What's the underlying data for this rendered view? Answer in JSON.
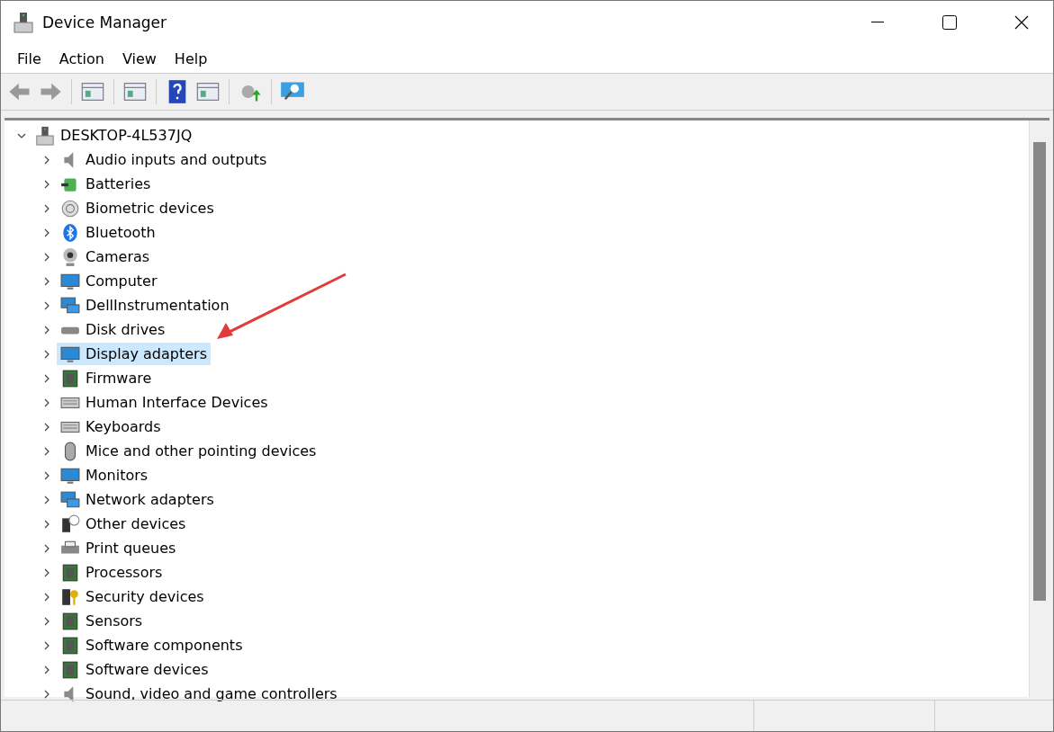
{
  "window": {
    "title": "Device Manager"
  },
  "menu": [
    "File",
    "Action",
    "View",
    "Help"
  ],
  "tree": {
    "label": "DESKTOP-4L537JQ",
    "expanded": true,
    "children": [
      {
        "label": "Audio inputs and outputs",
        "expanded": false,
        "selected": false
      },
      {
        "label": "Batteries",
        "expanded": false,
        "selected": false
      },
      {
        "label": "Biometric devices",
        "expanded": false,
        "selected": false
      },
      {
        "label": "Bluetooth",
        "expanded": false,
        "selected": false
      },
      {
        "label": "Cameras",
        "expanded": false,
        "selected": false
      },
      {
        "label": "Computer",
        "expanded": false,
        "selected": false
      },
      {
        "label": "DellInstrumentation",
        "expanded": false,
        "selected": false
      },
      {
        "label": "Disk drives",
        "expanded": false,
        "selected": false
      },
      {
        "label": "Display adapters",
        "expanded": false,
        "selected": true
      },
      {
        "label": "Firmware",
        "expanded": false,
        "selected": false
      },
      {
        "label": "Human Interface Devices",
        "expanded": false,
        "selected": false
      },
      {
        "label": "Keyboards",
        "expanded": false,
        "selected": false
      },
      {
        "label": "Mice and other pointing devices",
        "expanded": false,
        "selected": false
      },
      {
        "label": "Monitors",
        "expanded": false,
        "selected": false
      },
      {
        "label": "Network adapters",
        "expanded": false,
        "selected": false
      },
      {
        "label": "Other devices",
        "expanded": false,
        "selected": false
      },
      {
        "label": "Print queues",
        "expanded": false,
        "selected": false
      },
      {
        "label": "Processors",
        "expanded": false,
        "selected": false
      },
      {
        "label": "Security devices",
        "expanded": false,
        "selected": false
      },
      {
        "label": "Sensors",
        "expanded": false,
        "selected": false
      },
      {
        "label": "Software components",
        "expanded": false,
        "selected": false
      },
      {
        "label": "Software devices",
        "expanded": false,
        "selected": false
      },
      {
        "label": "Sound, video and game controllers",
        "expanded": false,
        "selected": false
      }
    ]
  }
}
